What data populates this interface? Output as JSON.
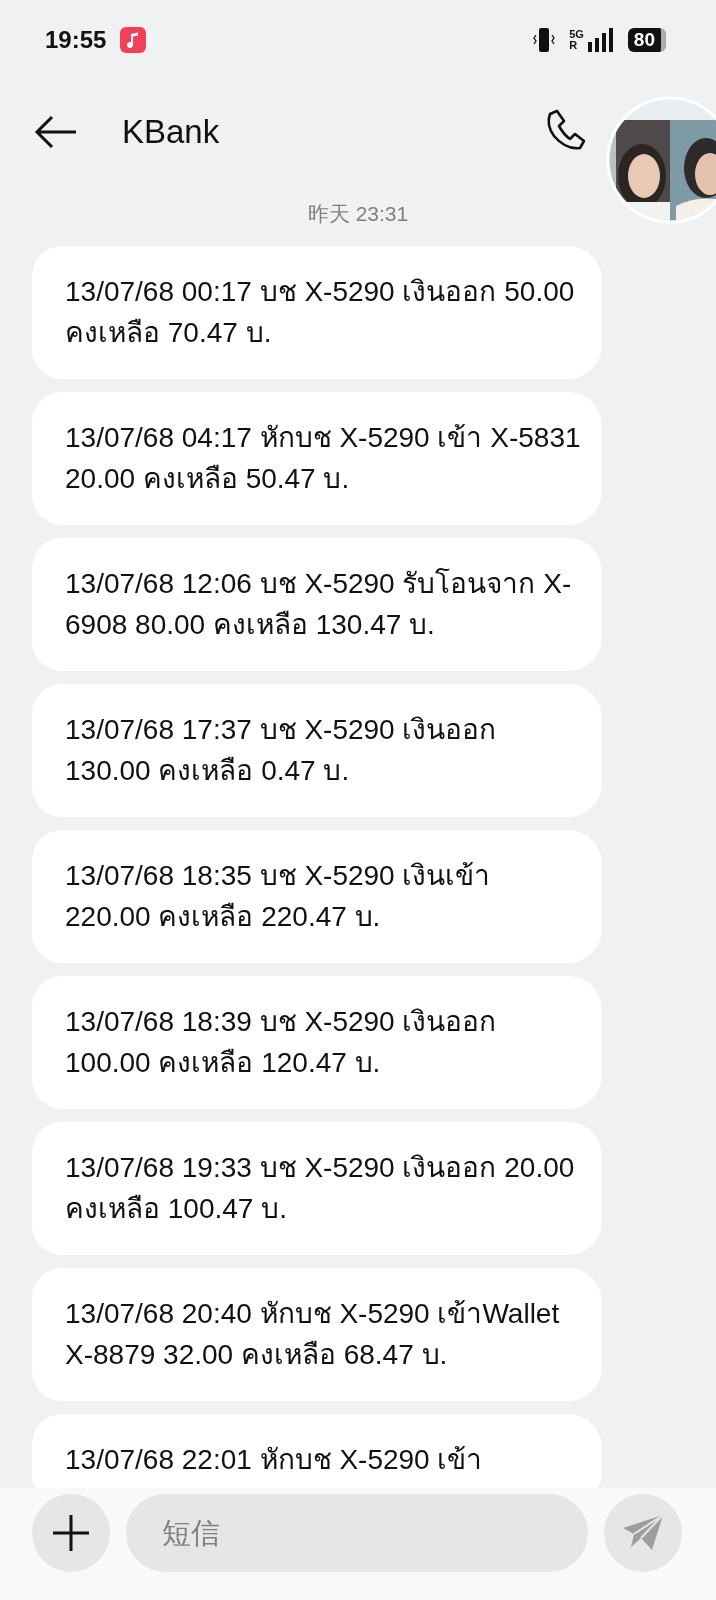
{
  "status_bar": {
    "time": "19:55",
    "network": "5G",
    "roaming": "R",
    "battery": "80"
  },
  "header": {
    "title": "KBank"
  },
  "timestamp": "昨天 23:31",
  "messages": [
    {
      "text": "13/07/68 00:17 บช X-5290 เงินออก 50.00 คงเหลือ 70.47 บ."
    },
    {
      "text": "13/07/68 04:17 หักบช X-5290 เข้า X-5831 20.00 คงเหลือ 50.47 บ."
    },
    {
      "text": "13/07/68 12:06 บช X-5290 รับโอนจาก X-6908 80.00 คงเหลือ 130.47 บ."
    },
    {
      "text": "13/07/68 17:37 บช X-5290 เงินออก 130.00 คงเหลือ 0.47 บ."
    },
    {
      "text": "13/07/68 18:35 บช X-5290 เงินเข้า 220.00 คงเหลือ 220.47 บ."
    },
    {
      "text": "13/07/68 18:39 บช X-5290 เงินออก 100.00 คงเหลือ 120.47 บ."
    },
    {
      "text": "13/07/68 19:33 บช X-5290 เงินออก 20.00 คงเหลือ 100.47 บ."
    },
    {
      "text": "13/07/68 20:40 หักบช X-5290 เข้าWallet X-8879 32.00 คงเหลือ 68.47 บ."
    },
    {
      "text": "13/07/68 22:01 หักบช X-5290 เข้า"
    }
  ],
  "composer": {
    "placeholder": "短信"
  }
}
